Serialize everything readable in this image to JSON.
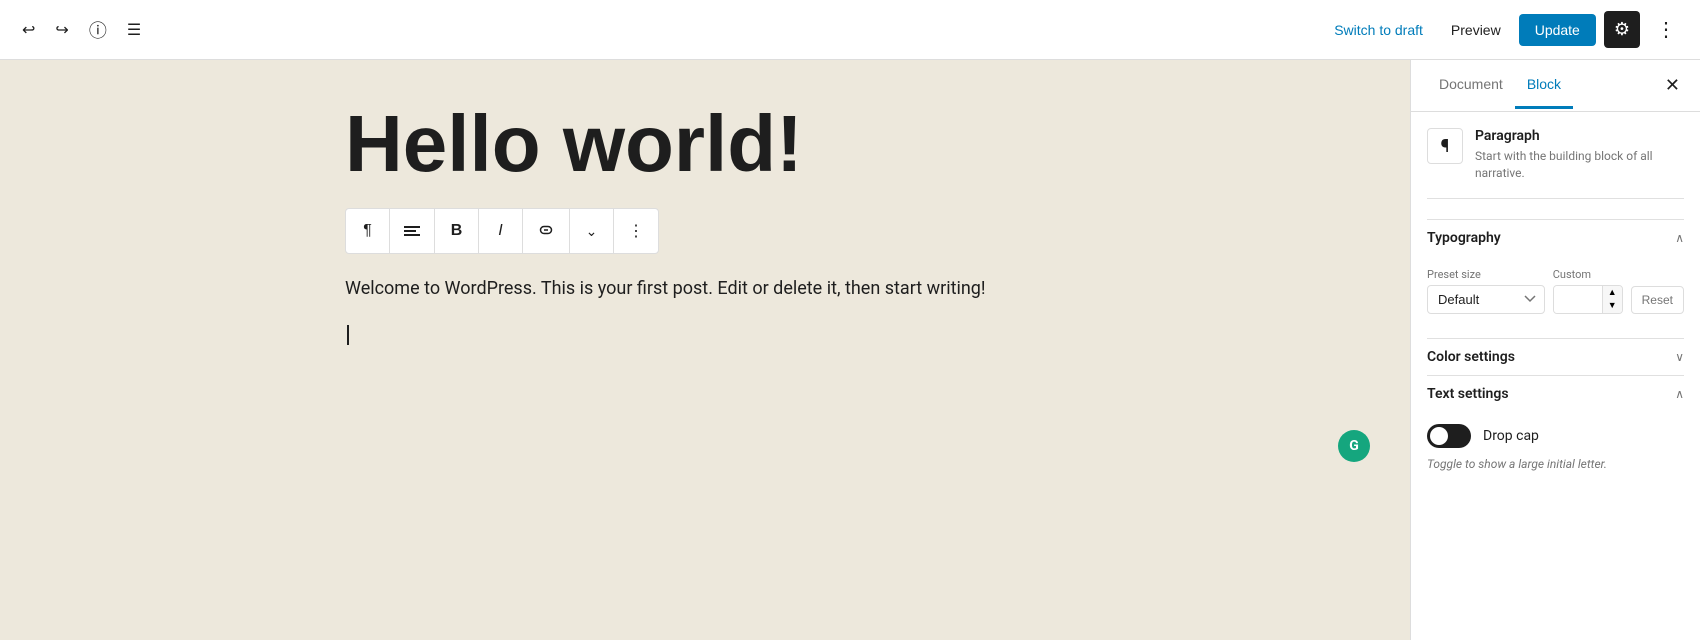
{
  "topbar": {
    "switch_to_draft": "Switch to draft",
    "preview": "Preview",
    "update": "Update"
  },
  "sidebar": {
    "doc_tab": "Document",
    "block_tab": "Block",
    "block_type": {
      "name": "Paragraph",
      "description": "Start with the building block of all narrative."
    },
    "typography": {
      "label": "Typography",
      "preset_label": "Preset size",
      "custom_label": "Custom",
      "preset_default": "Default",
      "reset_label": "Reset"
    },
    "color_settings": {
      "label": "Color settings"
    },
    "text_settings": {
      "label": "Text settings",
      "drop_cap_label": "Drop cap",
      "drop_cap_hint": "Toggle to show a large initial letter."
    }
  },
  "editor": {
    "title": "Hello world!",
    "body": "Welcome to WordPress. This is your first post. Edit or delete it, then start writing!"
  },
  "icons": {
    "undo": "↩",
    "redo": "↪",
    "info": "ⓘ",
    "list_view": "≡",
    "settings": "⚙",
    "more": "⋮",
    "close": "✕",
    "paragraph": "¶",
    "align_left": "≡",
    "bold": "B",
    "italic": "I",
    "link": "🔗",
    "more_options": "⋮",
    "chevron_up": "∧",
    "chevron_down": "∨",
    "grammarly": "G"
  }
}
